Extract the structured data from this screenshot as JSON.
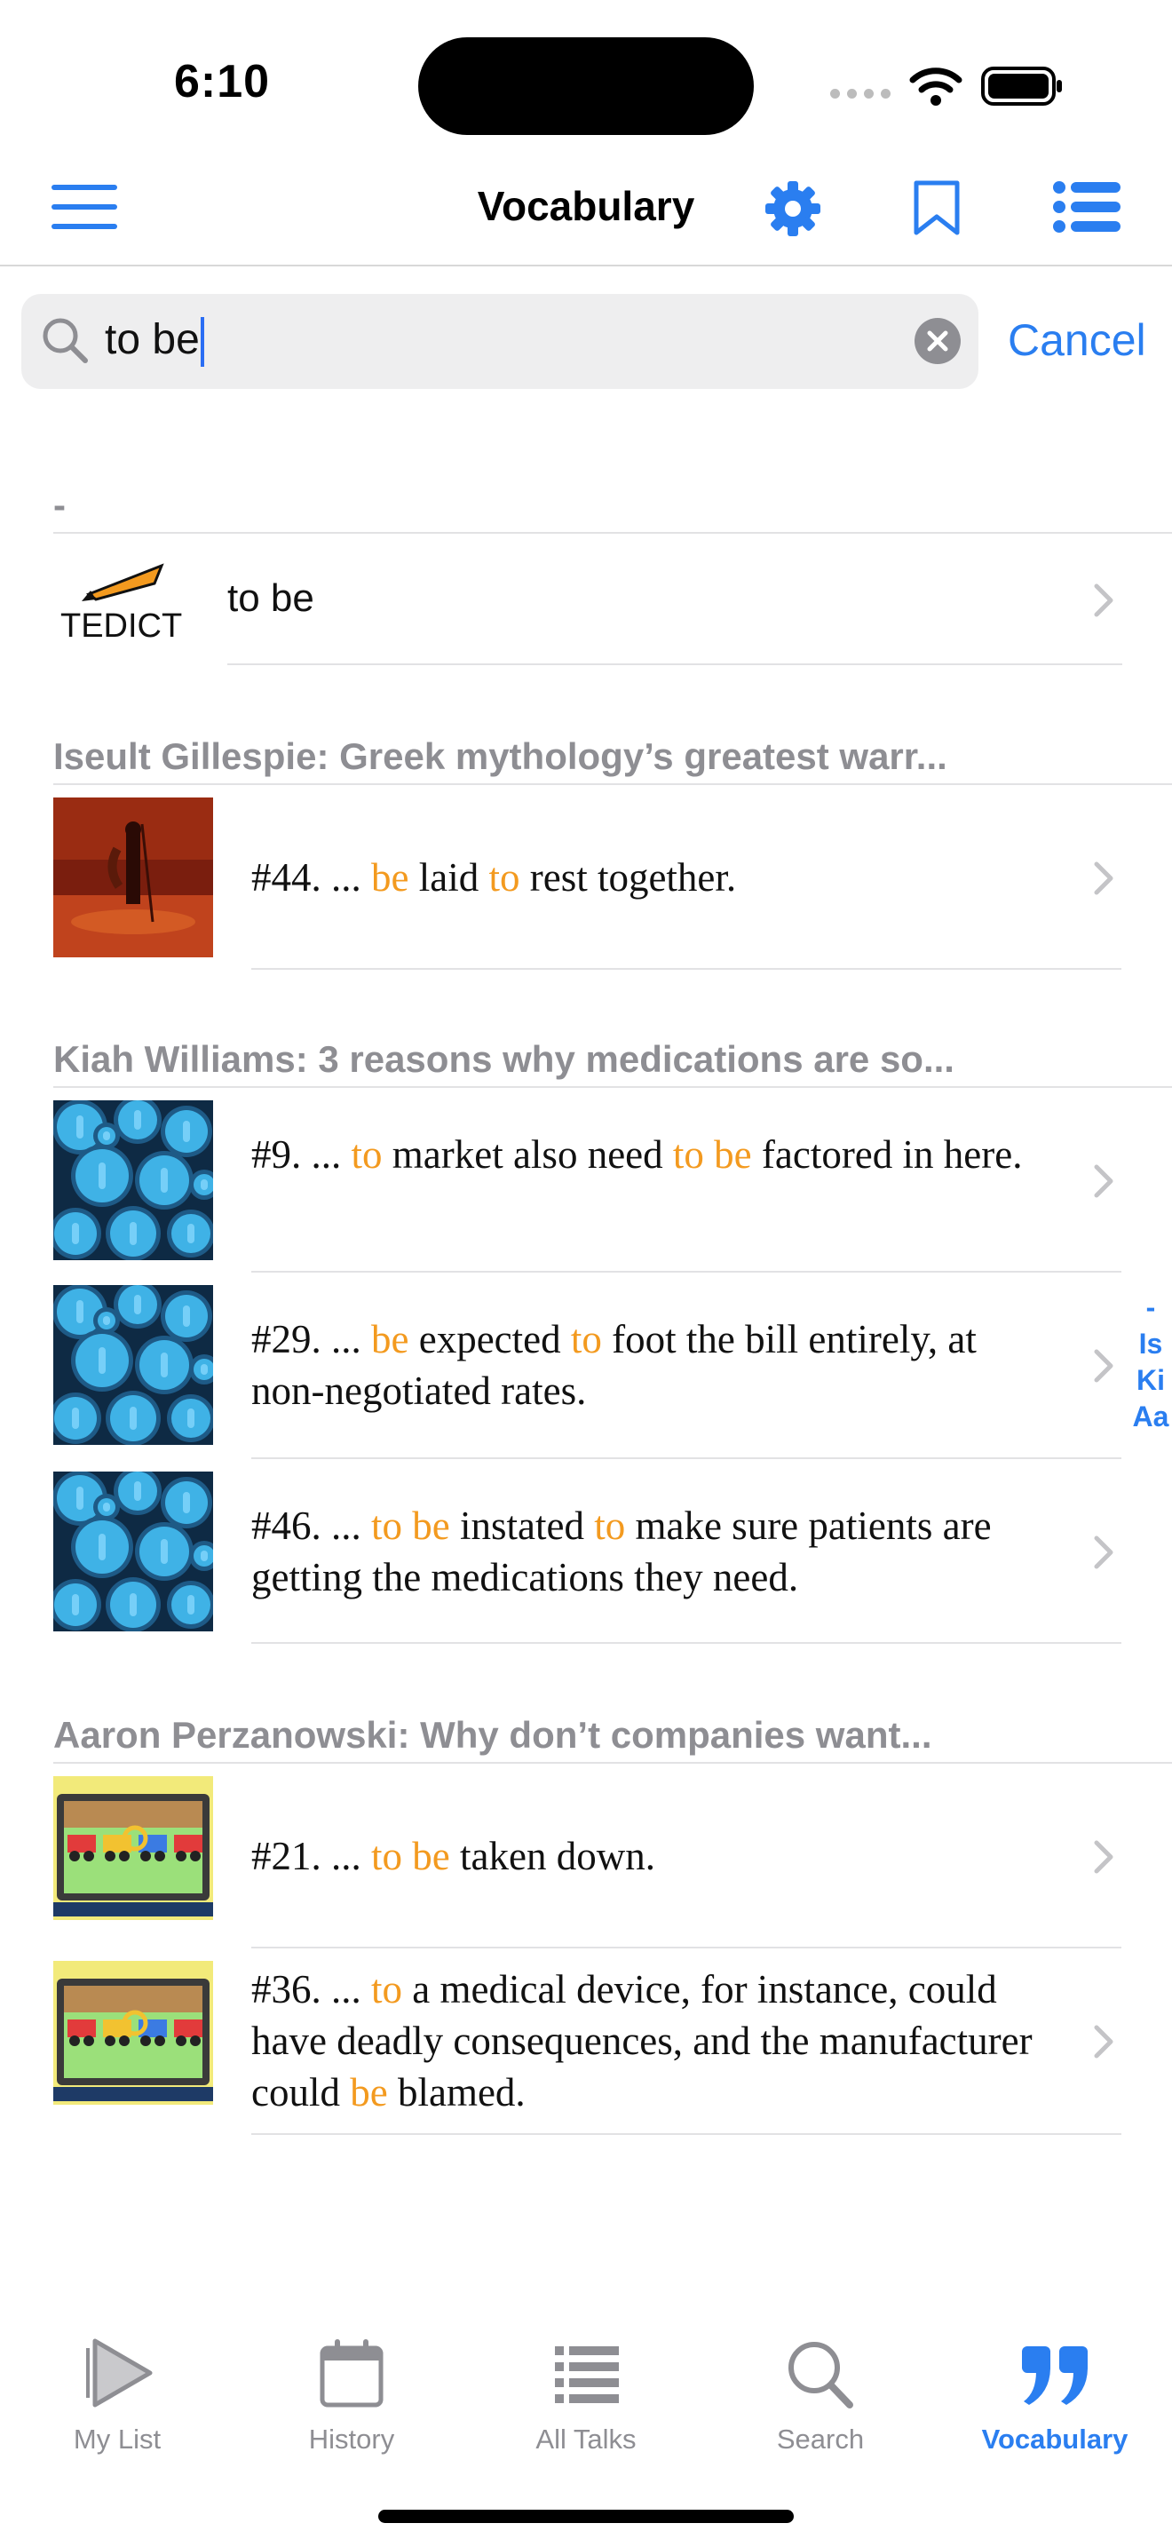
{
  "status": {
    "time": "6:10"
  },
  "nav": {
    "title": "Vocabulary"
  },
  "search": {
    "value": "to be",
    "cancel_label": "Cancel"
  },
  "sections": [
    {
      "header": "-",
      "rows": [
        {
          "kind": "dictionary",
          "logo_text": "TEDICT",
          "text": "to be"
        }
      ]
    },
    {
      "header": "Iseult Gillespie: Greek mythology’s greatest warr...",
      "rows": [
        {
          "number": "#44.",
          "parts": [
            [
              "... ",
              0
            ],
            [
              "be",
              1
            ],
            [
              " laid ",
              0
            ],
            [
              "to",
              1
            ],
            [
              " rest together.",
              0
            ]
          ]
        }
      ]
    },
    {
      "header": "Kiah Williams: 3 reasons why medications are so...",
      "rows": [
        {
          "number": "#9.",
          "parts": [
            [
              "... ",
              0
            ],
            [
              "to",
              1
            ],
            [
              " market also need ",
              0
            ],
            [
              "to",
              1
            ],
            [
              " ",
              0
            ],
            [
              "be",
              1
            ],
            [
              " factored in here.",
              0
            ]
          ]
        },
        {
          "number": "#29.",
          "parts": [
            [
              "... ",
              0
            ],
            [
              "be",
              1
            ],
            [
              " expected ",
              0
            ],
            [
              "to",
              1
            ],
            [
              " foot the bill entirely, at non-negotiated rates.",
              0
            ]
          ]
        },
        {
          "number": "#46.",
          "parts": [
            [
              "... ",
              0
            ],
            [
              "to",
              1
            ],
            [
              " ",
              0
            ],
            [
              "be",
              1
            ],
            [
              " instated ",
              0
            ],
            [
              "to",
              1
            ],
            [
              " make sure patients are getting the medications they need.",
              0
            ]
          ]
        }
      ]
    },
    {
      "header": "Aaron Perzanowski: Why don’t companies want...",
      "rows": [
        {
          "number": "#21.",
          "parts": [
            [
              "... ",
              0
            ],
            [
              "to",
              1
            ],
            [
              " ",
              0
            ],
            [
              "be",
              1
            ],
            [
              " taken down.",
              0
            ]
          ]
        },
        {
          "number": "#36.",
          "parts": [
            [
              "... ",
              0
            ],
            [
              "to",
              1
            ],
            [
              " a medical device, for instance, could have deadly consequences, and the manufacturer could ",
              0
            ],
            [
              "be",
              1
            ],
            [
              " blamed.",
              0
            ]
          ]
        }
      ]
    }
  ],
  "index_bar": [
    "-",
    "Is",
    "Ki",
    "Aa"
  ],
  "tabs": [
    {
      "label": "My List",
      "icon": "play-icon"
    },
    {
      "label": "History",
      "icon": "calendar-icon"
    },
    {
      "label": "All Talks",
      "icon": "list-icon"
    },
    {
      "label": "Search",
      "icon": "search-icon"
    },
    {
      "label": "Vocabulary",
      "icon": "quote-icon",
      "active": true
    }
  ],
  "colors": {
    "accent": "#2a7ef0",
    "highlight": "#f39a1f",
    "secondary_text": "#8e8e93"
  }
}
